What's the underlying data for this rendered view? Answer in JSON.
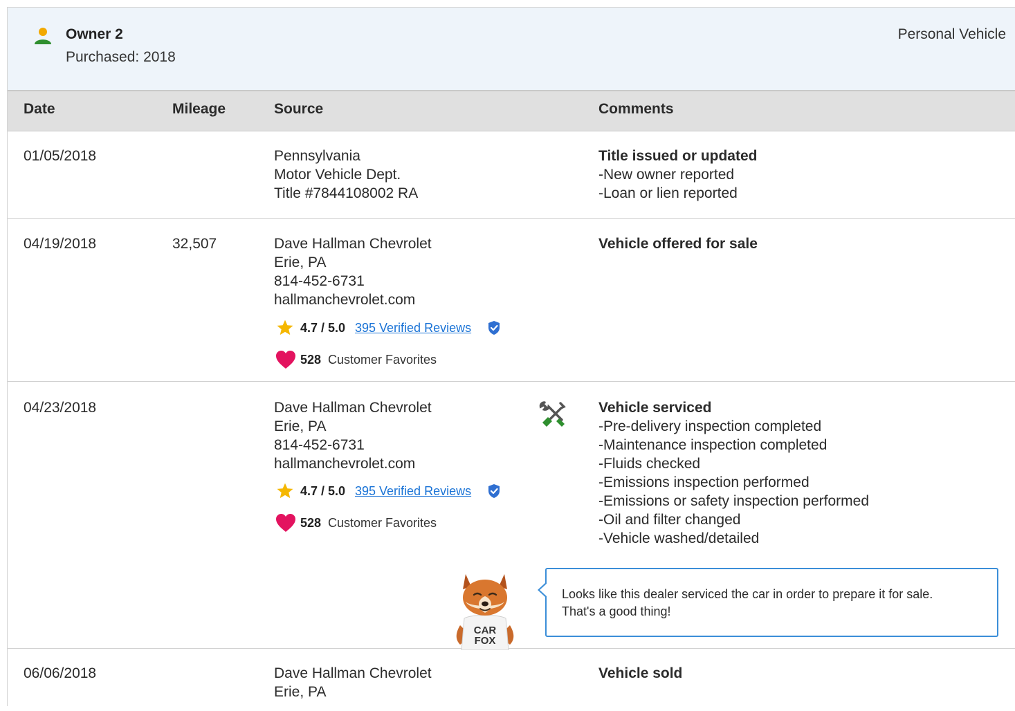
{
  "owner": {
    "title": "Owner 2",
    "purchased": "Purchased: 2018",
    "vehicle_type": "Personal Vehicle"
  },
  "table": {
    "headers": [
      "Date",
      "Mileage",
      "Source",
      "Comments"
    ]
  },
  "rows": [
    {
      "date": "01/05/2018",
      "mileage": "",
      "source": [
        "Pennsylvania",
        "Motor Vehicle Dept.",
        "Title #7844108002 RA"
      ],
      "comment_title": "Title issued or updated",
      "comment_items": [
        "New owner reported",
        "Loan or lien reported"
      ]
    },
    {
      "date": "04/19/2018",
      "mileage": "32,507",
      "source": [
        "Dave Hallman Chevrolet",
        "Erie, PA",
        "814-452-6731",
        "hallmanchevrolet.com"
      ],
      "rating": {
        "score": "4.7 / 5.0",
        "reviews_link": "395 Verified Reviews"
      },
      "favorites": {
        "count": "528",
        "label": "Customer Favorites"
      },
      "comment_title": "Vehicle offered for sale",
      "comment_items": []
    },
    {
      "date": "04/23/2018",
      "mileage": "",
      "source": [
        "Dave Hallman Chevrolet",
        "Erie, PA",
        "814-452-6731",
        "hallmanchevrolet.com"
      ],
      "rating": {
        "score": "4.7 / 5.0",
        "reviews_link": "395 Verified Reviews"
      },
      "favorites": {
        "count": "528",
        "label": "Customer Favorites"
      },
      "icon": "service-tools-icon",
      "comment_title": "Vehicle serviced",
      "comment_items": [
        "Pre-delivery inspection completed",
        "Maintenance inspection completed",
        "Fluids checked",
        "Emissions inspection performed",
        "Emissions or safety inspection performed",
        "Oil and filter changed",
        "Vehicle washed/detailed"
      ],
      "tip": {
        "lines": [
          "Looks like this dealer serviced the car in order to prepare it for sale.",
          "That's a good thing!"
        ],
        "mascot_shirt": [
          "CAR",
          "FOX"
        ]
      }
    },
    {
      "date": "06/06/2018",
      "mileage": "",
      "source": [
        "Dave Hallman Chevrolet",
        "Erie, PA"
      ],
      "comment_title": "Vehicle sold",
      "comment_items": []
    }
  ],
  "colors": {
    "header_bg": "#eef4fa",
    "table_head_bg": "#e0e0e0",
    "link": "#1a73d6",
    "star": "#f5b700",
    "heart": "#e3135f",
    "verified": "#2f6fd1",
    "owner_icon_head": "#f2a900",
    "owner_icon_body": "#2f8f2f",
    "bubble_border": "#3b8ed8"
  }
}
